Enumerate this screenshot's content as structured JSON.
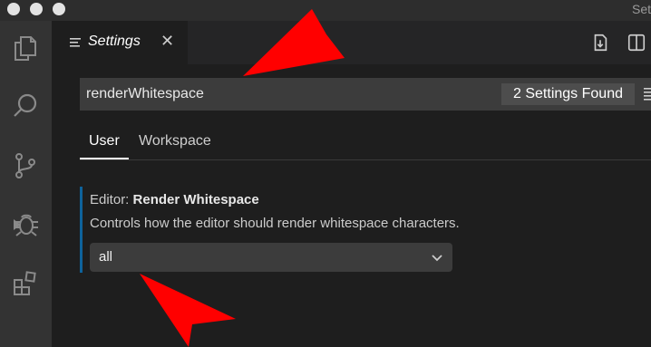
{
  "window": {
    "title": "Set"
  },
  "tab": {
    "label": "Settings",
    "close_glyph": "✕"
  },
  "search": {
    "value": "renderWhitespace",
    "result_badge": "2 Settings Found"
  },
  "scope_tabs": [
    {
      "label": "User"
    },
    {
      "label": "Workspace"
    }
  ],
  "setting": {
    "category": "Editor:",
    "name": "Render Whitespace",
    "description": "Controls how the editor should render whitespace characters.",
    "selected_value": "all"
  },
  "icons": {
    "activity": [
      "files-icon",
      "search-icon",
      "source-control-icon",
      "debug-icon",
      "extensions-icon"
    ],
    "tab": "settings-lines-icon",
    "toolbar": [
      "open-settings-json-icon",
      "split-editor-icon"
    ],
    "search_filter": "filter-icon",
    "select": "chevron-down-icon"
  },
  "colors": {
    "accent_bar": "#0e639c",
    "annotation_arrow": "#ff0000"
  }
}
